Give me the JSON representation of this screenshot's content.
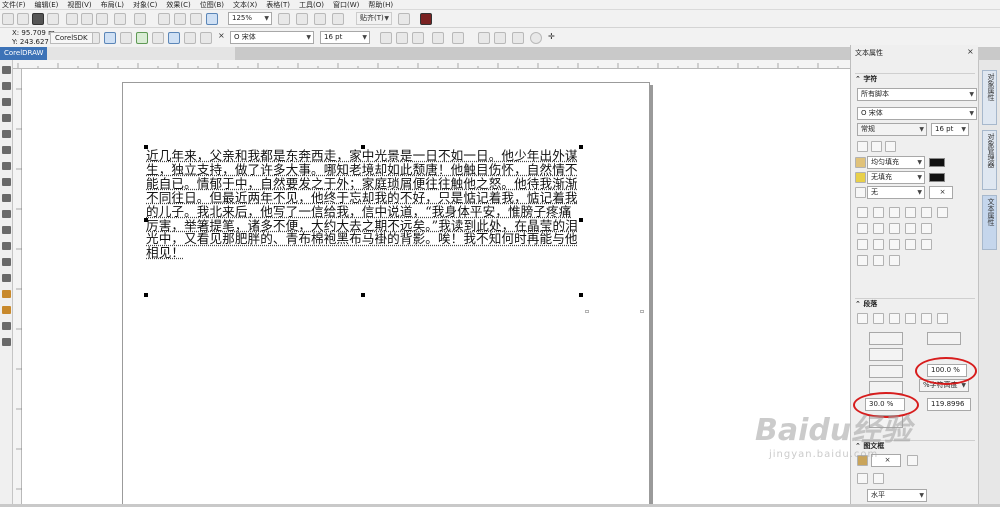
{
  "menu": [
    "文件(F)",
    "编辑(E)",
    "视图(V)",
    "布局(L)",
    "对象(C)",
    "效果(C)",
    "位图(B)",
    "文本(X)",
    "表格(T)",
    "工具(O)",
    "窗口(W)",
    "帮助(H)"
  ],
  "toolbar": {
    "zoom_value": "125%",
    "snap_label": "贴齐(T)"
  },
  "property_bar": {
    "x_coord": "X: 95.709 m",
    "y_coord": "Y: 243.627 m",
    "font_name": "宋体",
    "font_size": "16 pt"
  },
  "tabs": {
    "sdk_tab": "CorelSDK",
    "doc_tab": "CorelDRAW"
  },
  "document": {
    "paragraph": "近几年来，父亲和我都是东奔西走，家中光景是一日不如一日。他少年出外谋生，独立支持，做了许多大事。哪知老境却如此颓唐！他触目伤怀，自然情不能自已。情郁于中，自然要发之于外；家庭琐屑便往往触他之怒。他待我渐渐不同往日。但最近两年不见，他终于忘却我的不好，只是惦记着我，惦记着我的儿子。我北来后，他写了一信给我，信中说道，“我身体平安，惟膀子疼痛厉害，举箸提笔，诸多不便，大约大去之期不远矣。”我读到此处，在晶莹的泪光中，又看见那肥胖的、青布棉袍黑布马褂的背影。唉！我不知何时再能与他相见！"
  },
  "panel": {
    "title": "文本属性",
    "char_section": "字符",
    "script_select": "所有脚本",
    "font_name": "宋体",
    "font_style": "常规",
    "font_size": "16 pt",
    "fill_type": "均匀填充",
    "bg_fill_type": "无填充",
    "outline": "无",
    "para_section": "段落",
    "line_spacing": "100.0 %",
    "spacing_unit": "%字符高度",
    "char_spacing": "30.0 %",
    "word_spacing": "119.8996",
    "frame_section": "图文框",
    "wrap_option": "水平"
  },
  "side_tabs": [
    "对象属性",
    "对象管理器",
    "文本属性"
  ],
  "watermark": {
    "brand": "Baidu经验",
    "url": "jingyan.baidu.com"
  },
  "colors": {
    "accent": "#3d73b7",
    "highlight_circle": "#d71d1d",
    "canvas": "#ffffff"
  }
}
